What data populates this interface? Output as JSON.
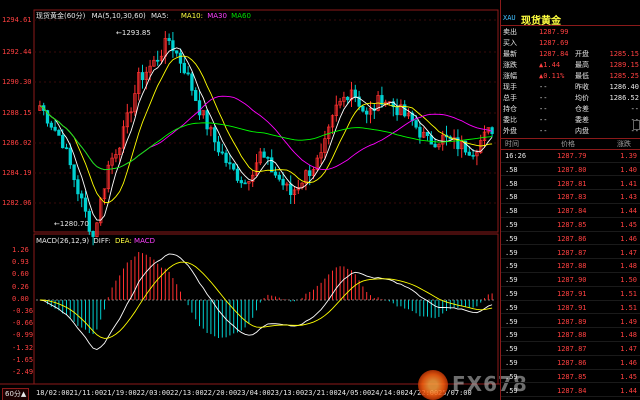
{
  "chart": {
    "title": "现货黄金",
    "period": "(60分)",
    "ma_label": "MA(5,10,30,60)",
    "ma5": "MA5:",
    "ma10": "MA10:",
    "ma30": "MA30",
    "ma60": "MA60",
    "high_marker": "1293.85",
    "low_marker": "1280.70",
    "price_ticks": [
      "1294.61",
      "1292.44",
      "1290.30",
      "1288.15",
      "1286.02",
      "1284.19",
      "1282.06"
    ],
    "period_button": "60分",
    "colors": {
      "up": "#ff3030",
      "down": "#00d0d0",
      "ma5": "#ffffff",
      "ma10": "#ffff00",
      "ma30": "#ff00ff",
      "ma60": "#00ff00",
      "grid": "#8b1a1a"
    }
  },
  "macd": {
    "label": "MACD(26,12,9)",
    "diff": "DIFF:",
    "dea": "DEA:",
    "macd": "MACD",
    "ticks": [
      "1.26",
      "0.93",
      "0.60",
      "0.26",
      "0.00",
      "-0.36",
      "-0.66",
      "-0.99",
      "-1.32",
      "-1.65",
      "-2.49"
    ]
  },
  "xaxis": {
    "labels": [
      "18/02:00",
      "21/11:00",
      "21/19:00",
      "22/03:00",
      "22/13:00",
      "22/20:00",
      "23/04:00",
      "23/13:00",
      "23/21:00",
      "24/05:00",
      "24/14:00",
      "24/22:00",
      "25/07:00"
    ]
  },
  "panel": {
    "symbol": "XAU",
    "name": "现货黄金",
    "quotes": [
      {
        "l1": "卖出",
        "v1": "1287.99",
        "c1": "red",
        "l2": "",
        "v2": ""
      },
      {
        "l1": "买入",
        "v1": "1287.69",
        "c1": "red",
        "l2": "",
        "v2": ""
      },
      {
        "l1": "最新",
        "v1": "1287.84",
        "c1": "red",
        "l2": "开盘",
        "v2": "1285.15"
      },
      {
        "l1": "涨跌",
        "v1": "▲1.44",
        "c1": "red",
        "l2": "最高",
        "v2": "1289.15"
      },
      {
        "l1": "涨幅",
        "v1": "▲0.11%",
        "c1": "red",
        "l2": "最低",
        "v2": "1285.25"
      },
      {
        "l1": "现手",
        "v1": "--",
        "c1": "white",
        "l2": "昨收",
        "v2": "1286.40"
      },
      {
        "l1": "总手",
        "v1": "--",
        "c1": "white",
        "l2": "均价",
        "v2": "1286.52"
      },
      {
        "l1": "持仓",
        "v1": "--",
        "c1": "white",
        "l2": "仓差",
        "v2": "--"
      },
      {
        "l1": "委比",
        "v1": "--",
        "c1": "white",
        "l2": "委差",
        "v2": "--"
      },
      {
        "l1": "外盘",
        "v1": "--",
        "c1": "white",
        "l2": "内盘",
        "v2": "--"
      }
    ],
    "ticks_header": {
      "time": "时间",
      "price": "价格",
      "change": "涨跌"
    },
    "ticks": [
      {
        "time": "16:26",
        "price": "1287.79",
        "change": "1.39"
      },
      {
        "time": ".58",
        "price": "1287.80",
        "change": "1.40"
      },
      {
        "time": ".58",
        "price": "1287.81",
        "change": "1.41"
      },
      {
        "time": ".58",
        "price": "1287.83",
        "change": "1.43"
      },
      {
        "time": ".58",
        "price": "1287.84",
        "change": "1.44"
      },
      {
        "time": ".59",
        "price": "1287.85",
        "change": "1.45"
      },
      {
        "time": ".59",
        "price": "1287.86",
        "change": "1.46"
      },
      {
        "time": ".59",
        "price": "1287.87",
        "change": "1.47"
      },
      {
        "time": ".59",
        "price": "1287.88",
        "change": "1.48"
      },
      {
        "time": ".59",
        "price": "1287.90",
        "change": "1.50"
      },
      {
        "time": ".59",
        "price": "1287.91",
        "change": "1.51"
      },
      {
        "time": ".59",
        "price": "1287.91",
        "change": "1.51"
      },
      {
        "time": ".59",
        "price": "1287.89",
        "change": "1.49"
      },
      {
        "time": ".59",
        "price": "1287.88",
        "change": "1.48"
      },
      {
        "time": ".59",
        "price": "1287.87",
        "change": "1.47"
      },
      {
        "time": ".59",
        "price": "1287.86",
        "change": "1.46"
      },
      {
        "time": ".59",
        "price": "1287.85",
        "change": "1.45"
      },
      {
        "time": ".59",
        "price": "1287.84",
        "change": "1.44"
      }
    ]
  },
  "watermark": "FX678"
}
